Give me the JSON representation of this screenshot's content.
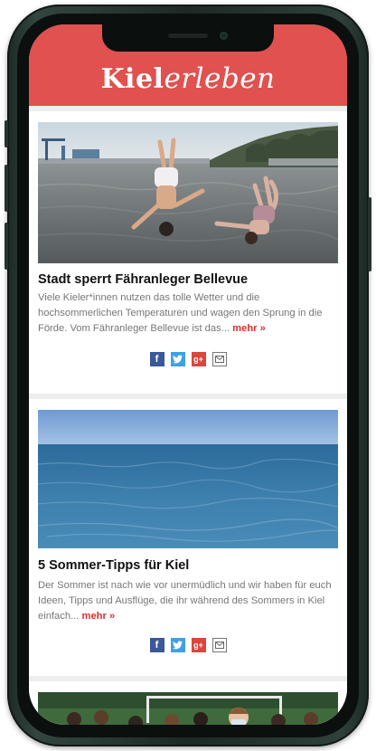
{
  "header": {
    "logo_part1": "Kiel",
    "logo_part2": "erleben",
    "color": "#e0514f"
  },
  "articles": [
    {
      "title": "Stadt sperrt Fähranleger Bellevue",
      "excerpt": "Viele Kieler*innen nutzen das tolle Wetter und die hochsommerlichen Temperaturen und wagen den Sprung in die Förde. Vom Fähranleger Bellevue ist das...",
      "more_label": "mehr »",
      "image_icon": "harbor-jumpers-photo"
    },
    {
      "title": "5 Sommer-Tipps für Kiel",
      "excerpt": "Der Sommer ist nach wie vor unermüdlich und wir haben für euch Ideen, Tipps und Ausflüge, die ihr während des Sommers in Kiel einfach...",
      "more_label": "mehr »",
      "image_icon": "sea-photo"
    },
    {
      "image_icon": "team-photo"
    }
  ],
  "share": {
    "facebook_label": "f",
    "google_label": "g+",
    "colors": {
      "facebook": "#3b5998",
      "twitter": "#3fa1e3",
      "googleplus": "#d9473d"
    }
  }
}
